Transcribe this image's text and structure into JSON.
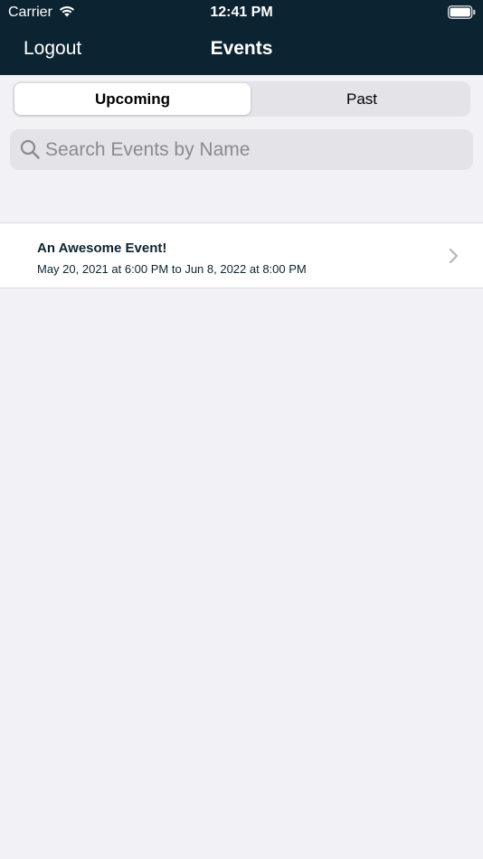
{
  "status_bar": {
    "carrier": "Carrier",
    "time": "12:41 PM"
  },
  "nav": {
    "logout_label": "Logout",
    "title": "Events"
  },
  "segments": {
    "upcoming_label": "Upcoming",
    "past_label": "Past",
    "selected": "Upcoming"
  },
  "search": {
    "placeholder": "Search Events by Name",
    "value": ""
  },
  "events": [
    {
      "title": "An Awesome Event!",
      "dates": "May 20, 2021 at 6:00 PM to Jun  8, 2022 at 8:00 PM"
    }
  ],
  "colors": {
    "header_bg": "#0c2431",
    "page_bg": "#f1f1f6",
    "text_accent": "#0c2431"
  },
  "icons": [
    "wifi-icon",
    "battery-icon",
    "search-icon",
    "chevron-right-icon"
  ]
}
